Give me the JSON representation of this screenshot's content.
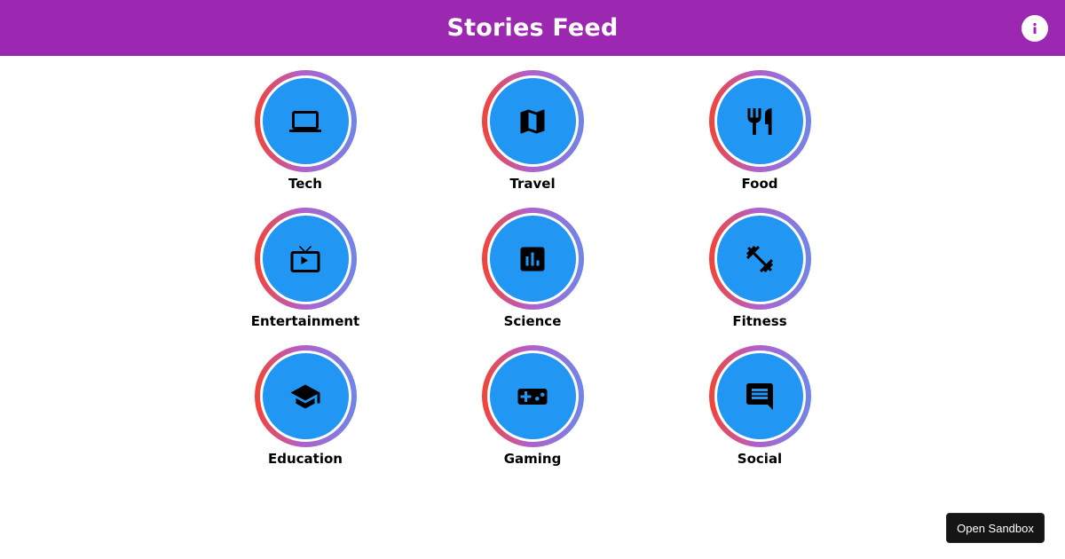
{
  "header": {
    "title": "Stories Feed",
    "info_icon": "info-icon",
    "background": "#9c27b0"
  },
  "stories": [
    {
      "label": "Tech",
      "icon": "laptop-icon"
    },
    {
      "label": "Travel",
      "icon": "map-icon"
    },
    {
      "label": "Food",
      "icon": "fork-knife-icon"
    },
    {
      "label": "Entertainment",
      "icon": "tv-icon"
    },
    {
      "label": "Science",
      "icon": "bar-chart-icon"
    },
    {
      "label": "Fitness",
      "icon": "dumbbell-icon"
    },
    {
      "label": "Education",
      "icon": "graduation-cap-icon"
    },
    {
      "label": "Gaming",
      "icon": "gamepad-icon"
    },
    {
      "label": "Social",
      "icon": "chat-bubble-icon"
    }
  ],
  "colors": {
    "circle": "#2196f3",
    "ring_start": "#f44336",
    "ring_end": "#6f86e8"
  },
  "sandbox": {
    "label": "Open Sandbox"
  }
}
